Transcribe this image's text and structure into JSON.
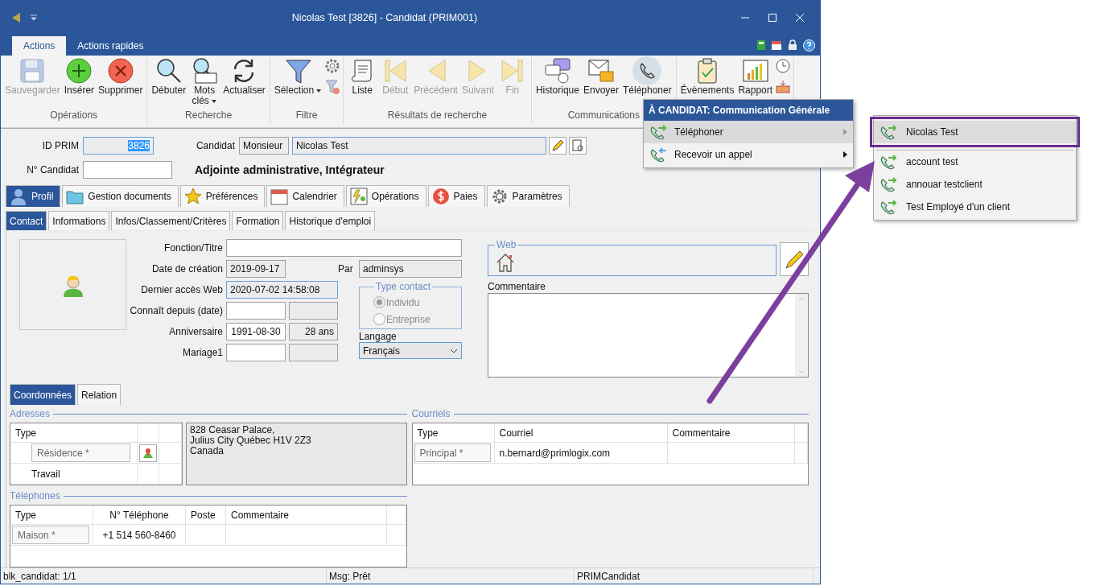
{
  "window": {
    "title": "Nicolas Test [3826] - Candidat (PRIM001)"
  },
  "ribbon_tabs": [
    {
      "label": "Actions",
      "selected": true
    },
    {
      "label": "Actions rapides",
      "selected": false
    }
  ],
  "ribbon_groups": [
    {
      "name": "Opérations",
      "buttons": [
        {
          "label": "Sauvegarder",
          "disabled": true,
          "active": false
        },
        {
          "label": "Insérer",
          "disabled": false,
          "active": false
        },
        {
          "label": "Supprimer",
          "disabled": false,
          "active": false
        }
      ]
    },
    {
      "name": "Recherche",
      "buttons": [
        {
          "label": "Débuter",
          "disabled": false,
          "active": false
        },
        {
          "label": "Mots clés",
          "disabled": false,
          "active": false,
          "has_menu": true
        },
        {
          "label": "Actualiser",
          "disabled": false,
          "active": false
        }
      ]
    },
    {
      "name": "Filtre",
      "buttons": [
        {
          "label": "Sélection",
          "disabled": false,
          "active": false,
          "has_menu": true
        }
      ]
    },
    {
      "name": "Résultats de recherche",
      "buttons": [
        {
          "label": "Liste",
          "disabled": false,
          "active": false
        },
        {
          "label": "Début",
          "disabled": true,
          "active": false
        },
        {
          "label": "Précédent",
          "disabled": true,
          "active": false
        },
        {
          "label": "Suivant",
          "disabled": true,
          "active": false
        },
        {
          "label": "Fin",
          "disabled": true,
          "active": false
        }
      ]
    },
    {
      "name": "Communications",
      "buttons": [
        {
          "label": "Historique",
          "disabled": false,
          "active": false
        },
        {
          "label": "Envoyer",
          "disabled": false,
          "active": false
        },
        {
          "label": "Téléphoner",
          "disabled": false,
          "active": true
        }
      ]
    },
    {
      "buttons": [
        {
          "label": "Évènements",
          "disabled": false,
          "active": false
        },
        {
          "label": "Rapport",
          "disabled": false,
          "active": false
        }
      ]
    }
  ],
  "header": {
    "id_label": "ID PRIM",
    "id_value": "3826",
    "candidate_label": "Candidat",
    "civility": "Monsieur",
    "name": "Nicolas Test",
    "number_label": "N° Candidat",
    "headline": "Adjointe administrative, Intégrateur"
  },
  "main_tabs": [
    {
      "label": "Profil",
      "selected": true
    },
    {
      "label": "Gestion documents",
      "selected": false
    },
    {
      "label": "Préférences",
      "selected": false
    },
    {
      "label": "Calendrier",
      "selected": false
    },
    {
      "label": "Opérations",
      "selected": false
    },
    {
      "label": "Paies",
      "selected": false
    },
    {
      "label": "Paramètres",
      "selected": false
    }
  ],
  "sub_tabs": [
    {
      "label": "Contact",
      "selected": true
    },
    {
      "label": "Informations",
      "selected": false
    },
    {
      "label": "Infos/Classement/Critères",
      "selected": false
    },
    {
      "label": "Formation",
      "selected": false
    },
    {
      "label": "Historique d'emploi",
      "selected": false
    }
  ],
  "contact": {
    "title_label": "Fonction/Titre",
    "created_label": "Date de création",
    "created_value": "2019-09-17",
    "by_label": "Par",
    "by_value": "adminsys",
    "web_access_label": "Dernier accès Web",
    "web_access_value": "2020-07-02 14:58:08",
    "known_label": "Connaît depuis (date)",
    "birthday_label": "Anniversaire",
    "birthday_value": "1991-08-30",
    "age": "28 ans",
    "marriage_label": "Mariage1"
  },
  "type_contact": {
    "label": "Type contact",
    "disabled": true,
    "options": [
      {
        "label": "Individu",
        "selected": true
      },
      {
        "label": "Entreprise",
        "selected": false
      }
    ]
  },
  "language": {
    "label": "Langage",
    "value": "Français"
  },
  "web": {
    "label": "Web"
  },
  "comment": {
    "label": "Commentaire"
  },
  "bottom_tabs": [
    {
      "label": "Coordonnées",
      "selected": true
    },
    {
      "label": "Relation",
      "selected": false
    }
  ],
  "addresses": {
    "title": "Adresses",
    "type_header": "Type",
    "rows": [
      {
        "type": "Résidence *",
        "selected": true
      },
      {
        "type": "Travail",
        "selected": false
      }
    ],
    "address_lines": [
      "828 Ceasar Palace,",
      "Julius City Québec H1V 2Z3",
      "Canada"
    ]
  },
  "emails": {
    "title": "Courriels",
    "columns": [
      "Type",
      "Courriel",
      "Commentaire"
    ],
    "rows": [
      [
        "Principal *",
        "n.bernard@primlogix.com",
        null
      ]
    ]
  },
  "phones": {
    "title": "Téléphones",
    "columns": [
      "Type",
      "N° Téléphone",
      "Poste",
      "Commentaire"
    ],
    "rows": [
      [
        "Maison *",
        "+1 514 560-8460",
        null,
        null
      ]
    ]
  },
  "status_bar": [
    "blk_candidat: 1/1",
    "Msg: Prêt",
    "PRIMCandidat"
  ],
  "popup_menu": {
    "title": "À CANDIDAT: Communication Générale",
    "items": [
      {
        "label": "Téléphoner",
        "selected": true,
        "kind": "outgoing"
      },
      {
        "label": "Recevoir un appel",
        "selected": false,
        "kind": "incoming"
      }
    ]
  },
  "submenu": {
    "items": [
      {
        "label": "Nicolas Test",
        "selected": true
      },
      {
        "label": "account test",
        "selected": false
      },
      {
        "label": "annouar testclient",
        "selected": false
      },
      {
        "label": "Test Employé d'un client",
        "selected": false
      }
    ]
  }
}
